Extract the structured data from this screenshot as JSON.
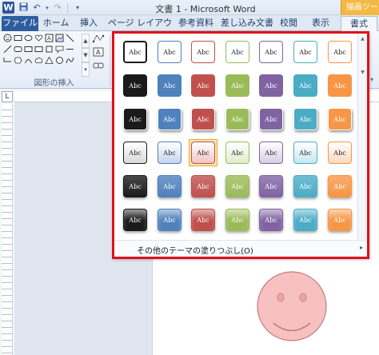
{
  "window": {
    "app_icon": "W",
    "title": "文書 1 - Microsoft Word",
    "context_tab_title": "描画ツール"
  },
  "qat": {
    "save_icon": "save-icon",
    "undo_icon": "undo-icon",
    "redo_icon": "redo-icon",
    "customize_icon": "customize-icon"
  },
  "tabs": [
    {
      "label": "ファイル",
      "state": "file"
    },
    {
      "label": "ホーム",
      "state": "normal"
    },
    {
      "label": "挿入",
      "state": "normal"
    },
    {
      "label": "ページ レイアウト",
      "state": "normal"
    },
    {
      "label": "参考資料",
      "state": "normal"
    },
    {
      "label": "差し込み文書",
      "state": "normal"
    },
    {
      "label": "校閲",
      "state": "normal"
    },
    {
      "label": "表示",
      "state": "normal"
    },
    {
      "label": "書式",
      "state": "active"
    }
  ],
  "ribbon": {
    "group_label": "図形の挿入",
    "shapes": [
      [
        "smiley-shape",
        "rectangle-shape",
        "oval-shape",
        "rounded-rect-shape",
        "textbox-shape",
        "line-shape"
      ],
      [
        "line-shape",
        "rounded-rect-shape",
        "square-shape",
        "rectangle-shape",
        "textbox-shape",
        "line-shape"
      ],
      [
        "connector-shape",
        "hexagon-shape",
        "arc-shape",
        "cloud-shape",
        "triangle-shape",
        "callout-shape"
      ]
    ]
  },
  "ruler": {
    "corner": "L"
  },
  "dropdown": {
    "cell_text": "Abc",
    "footer_label": "その他のテーマの塗りつぶし(O)",
    "selected_row": 3,
    "selected_col": 2,
    "colors": [
      "#1a1a1a",
      "#4f81bd",
      "#c0504d",
      "#9bbb59",
      "#8064a2",
      "#4bacc6",
      "#f79646"
    ],
    "light_colors": [
      "#d9d9d9",
      "#c5d5ee",
      "#f2c4c3",
      "#dfeccb",
      "#d6cce5",
      "#c6e6f0",
      "#fcd9bc"
    ],
    "row_styles": [
      "outline",
      "solid",
      "shadow",
      "light",
      "gloss",
      "gloss-dark"
    ]
  },
  "document": {
    "shape": "smiley-face",
    "shape_fill": "#f6c1c0"
  }
}
